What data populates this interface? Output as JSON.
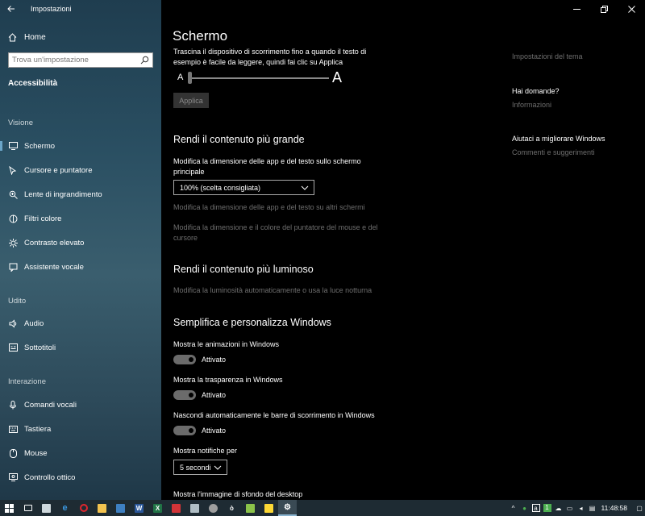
{
  "window": {
    "title": "Impostazioni"
  },
  "sidebar": {
    "home_label": "Home",
    "search_placeholder": "Trova un'impostazione",
    "section_title": "Accessibilità",
    "groups": [
      {
        "label": "Visione",
        "items": [
          {
            "label": "Schermo",
            "icon": "monitor-icon"
          },
          {
            "label": "Cursore e puntatore",
            "icon": "pointer-icon"
          },
          {
            "label": "Lente di ingrandimento",
            "icon": "magnifier-icon"
          },
          {
            "label": "Filtri colore",
            "icon": "color-filter-icon"
          },
          {
            "label": "Contrasto elevato",
            "icon": "contrast-icon"
          },
          {
            "label": "Assistente vocale",
            "icon": "narrator-icon"
          }
        ]
      },
      {
        "label": "Udito",
        "items": [
          {
            "label": "Audio",
            "icon": "speaker-icon"
          },
          {
            "label": "Sottotitoli",
            "icon": "captions-icon"
          }
        ]
      },
      {
        "label": "Interazione",
        "items": [
          {
            "label": "Comandi vocali",
            "icon": "microphone-icon"
          },
          {
            "label": "Tastiera",
            "icon": "keyboard-icon"
          },
          {
            "label": "Mouse",
            "icon": "mouse-icon"
          },
          {
            "label": "Controllo ottico",
            "icon": "eye-control-icon"
          }
        ]
      }
    ]
  },
  "main": {
    "title": "Schermo",
    "slider_description": "Trascina il dispositivo di scorrimento fino a quando il testo di esempio è facile da leggere, quindi fai clic su Applica",
    "slider_small_label": "A",
    "slider_big_label": "A",
    "text_size_level": 0,
    "apply_label": "Applica",
    "section_bigger": {
      "heading": "Rendi il contenuto più grande",
      "scale_label": "Modifica la dimensione delle app e del testo sullo schermo principale",
      "scale_value": "100% (scelta consigliata)",
      "link_other_screens": "Modifica la dimensione delle app e del testo su altri schermi",
      "link_pointer": "Modifica la dimensione e il colore del puntatore del mouse e del cursore"
    },
    "section_brighter": {
      "heading": "Rendi il contenuto più luminoso",
      "link_brightness": "Modifica la luminosità automaticamente o usa la luce notturna"
    },
    "section_simplify": {
      "heading": "Semplifica e personalizza Windows",
      "animations_label": "Mostra le animazioni in Windows",
      "animations_state": "Attivato",
      "transparency_label": "Mostra la trasparenza in Windows",
      "transparency_state": "Attivato",
      "scrollbars_label": "Nascondi automaticamente le barre di scorrimento in Windows",
      "scrollbars_state": "Attivato",
      "notifications_label": "Mostra notifiche per",
      "notifications_value": "5 secondi",
      "wallpaper_label": "Mostra l'immagine di sfondo del desktop"
    }
  },
  "right_panel": {
    "theme_settings": "Impostazioni del tema",
    "questions_heading": "Hai domande?",
    "info_link": "Informazioni",
    "improve_heading": "Aiutaci a migliorare Windows",
    "feedback_link": "Commenti e suggerimenti"
  },
  "taskbar": {
    "clock": "11:48:58",
    "apps": [
      "start-icon",
      "search-icon",
      "task-view-icon",
      "store-icon",
      "edge-icon",
      "opera-icon",
      "explorer-icon",
      "folder-icon",
      "word-icon",
      "excel-icon",
      "pdf-icon",
      "notepad-icon",
      "media-icon",
      "app-icon",
      "sticky-icon",
      "pen-icon",
      "settings-icon"
    ]
  },
  "colors": {
    "accent": "#6ba5c8",
    "sidebar_bg": "#2a4f62",
    "main_bg": "#000000",
    "disabled_text": "#6e6e6e"
  }
}
